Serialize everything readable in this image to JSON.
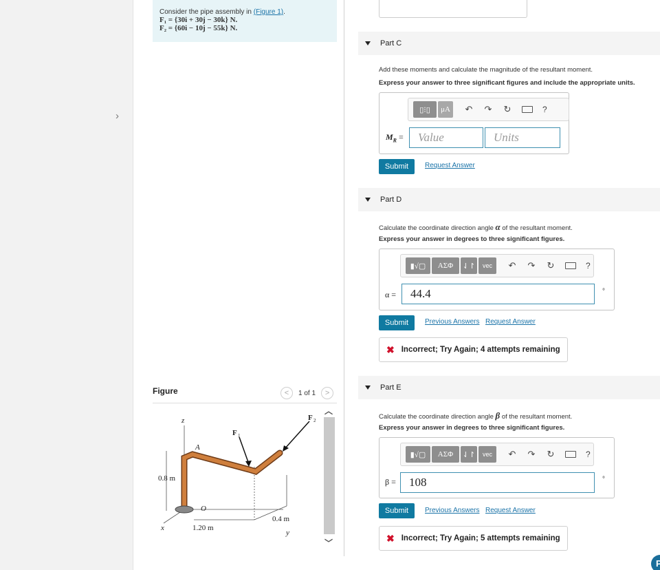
{
  "problem": {
    "intro": "Consider the pipe assembly in",
    "figure_link": "(Figure 1)",
    "intro_end": ".",
    "f1": "F₁ = {30i + 30j − 30k} N.",
    "f2": "F₂ = {60i − 10j − 55k} N."
  },
  "figure": {
    "label": "Figure",
    "page_count": "1 of 1",
    "prev_icon": "chevron-left",
    "next_icon": "chevron-right",
    "labels": {
      "z": "z",
      "a": "A",
      "f1": "F",
      "f1_sub": "1",
      "f2": "F",
      "f2_sub": "2",
      "height": "0.8 m",
      "o": "O",
      "x": "x",
      "len_x": "1.20 m",
      "len_y": "0.4 m",
      "y": "y"
    }
  },
  "part_c": {
    "title": "Part C",
    "prompt": "Add these moments and calculate the magnitude of the resultant moment.",
    "instruction": "Express your answer to three significant figures and include the appropriate units.",
    "toolbar": [
      "▯⁝▯",
      "μA"
    ],
    "label_sym": "M",
    "label_sub": "R",
    "label_eq": " =",
    "value_placeholder": "Value",
    "units_placeholder": "Units",
    "submit": "Submit",
    "request": "Request Answer"
  },
  "part_d": {
    "title": "Part D",
    "prompt_before": "Calculate the coordinate direction angle",
    "symbol": "α",
    "prompt_after": "of the resultant moment.",
    "instruction": "Express your answer in degrees to three significant figures.",
    "toolbar": [
      "▮√▢",
      "ΑΣΦ",
      "⇃↾",
      "vec"
    ],
    "label": "α =",
    "value": "44.4",
    "unit": "°",
    "submit": "Submit",
    "previous": "Previous Answers",
    "request": "Request Answer",
    "feedback": "Incorrect; Try Again; 4 attempts remaining"
  },
  "part_e": {
    "title": "Part E",
    "prompt_before": "Calculate the coordinate direction angle",
    "symbol": "β",
    "prompt_after": "of the resultant moment.",
    "instruction": "Express your answer in degrees to three significant figures.",
    "toolbar": [
      "▮√▢",
      "ΑΣΦ",
      "⇃↾",
      "vec"
    ],
    "label": "β =",
    "value": "108",
    "unit": "°",
    "submit": "Submit",
    "previous": "Previous Answers",
    "request": "Request Answer",
    "feedback": "Incorrect; Try Again; 5 attempts remaining"
  },
  "toolbar_icons": [
    "undo-icon",
    "redo-icon",
    "reset-icon",
    "keyboard-icon",
    "help-icon"
  ],
  "help_badge": "P",
  "colors": {
    "accent": "#107aa1",
    "link": "#1a73a8",
    "error": "#d0112b",
    "problem_bg": "#e7f4f7"
  }
}
